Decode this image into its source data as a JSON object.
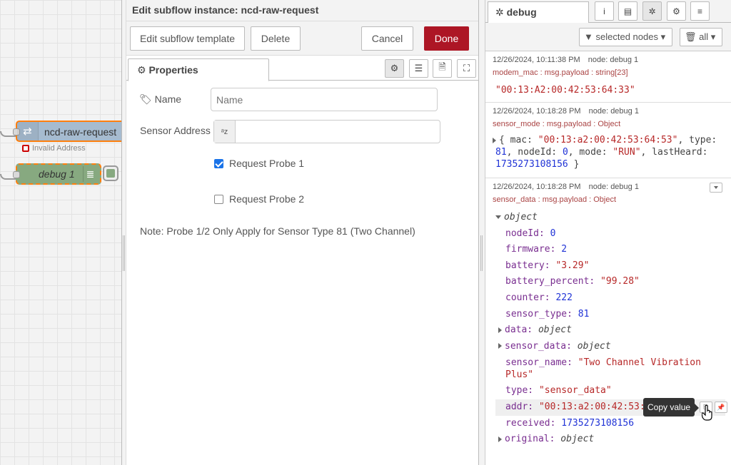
{
  "canvas": {
    "request_node_label": "ncd-raw-request",
    "request_node_icon": "arrows-icon",
    "status_text": "Invalid Address",
    "debug_node_label": "debug 1"
  },
  "tray": {
    "title": "Edit subflow instance: ncd-raw-request",
    "buttons": {
      "edit_template": "Edit subflow template",
      "delete": "Delete",
      "cancel": "Cancel",
      "done": "Done"
    },
    "tab_properties": "Properties",
    "form": {
      "name_label": "Name",
      "name_placeholder": "Name",
      "name_value": "",
      "sensor_address_label": "Sensor Address",
      "sensor_address_type": "a z",
      "sensor_address_value": "",
      "probe1_label": "Request Probe 1",
      "probe1_checked": true,
      "probe2_label": "Request Probe 2",
      "probe2_checked": false,
      "note": "Note: Probe 1/2 Only Apply for Sensor Type 81 (Two Channel)"
    }
  },
  "sidebar": {
    "tab_label": "debug",
    "filter_label": "selected nodes",
    "clear_label": "all",
    "messages": [
      {
        "time": "12/26/2024, 10:11:38 PM",
        "node": "node: debug 1",
        "topic": "modem_mac : msg.payload : string[23]",
        "value": "\"00:13:A2:00:42:53:64:33\""
      },
      {
        "time": "12/26/2024, 10:18:28 PM",
        "node": "node: debug 1",
        "topic": "sensor_mode : msg.payload : Object",
        "line1_pre": "{ mac: ",
        "line1_str": "\"00:13:a2:00:42:53:64:53\"",
        "line1_post": ", type:",
        "line2_num1": "81",
        "line2_a": ", nodeId: ",
        "line2_num2": "0",
        "line2_b": ", mode: ",
        "line2_str": "\"RUN\"",
        "line2_c": ", lastHeard:",
        "line3_num": "1735273108156",
        "line3_post": " }"
      },
      {
        "time": "12/26/2024, 10:18:28 PM",
        "node": "node: debug 1",
        "topic": "sensor_data : msg.payload : Object",
        "root": "object",
        "props": {
          "nodeId_k": "nodeId: ",
          "nodeId_v": "0",
          "firmware_k": "firmware: ",
          "firmware_v": "2",
          "battery_k": "battery: ",
          "battery_v": "\"3.29\"",
          "battery_percent_k": "battery_percent: ",
          "battery_percent_v": "\"99.28\"",
          "counter_k": "counter: ",
          "counter_v": "222",
          "sensor_type_k": "sensor_type: ",
          "sensor_type_v": "81",
          "data_k": "data: ",
          "data_v": "object",
          "sensor_data_k": "sensor_data: ",
          "sensor_data_v": "object",
          "sensor_name_k": "sensor_name: ",
          "sensor_name_v1": "\"Two Channel Vibration",
          "sensor_name_v2": "Plus\"",
          "type_k": "type: ",
          "type_v": "\"sensor_data\"",
          "addr_k": "addr: ",
          "addr_v": "\"00:13:a2:00:42:53:",
          "received_k": "received: ",
          "received_v": "1735273108156",
          "original_k": "original: ",
          "original_v": "object"
        }
      }
    ],
    "tooltip": "Copy value"
  },
  "colors": {
    "accent": "#ad1625",
    "string": "#b72828",
    "number": "#2033d6",
    "key": "#792e90"
  }
}
